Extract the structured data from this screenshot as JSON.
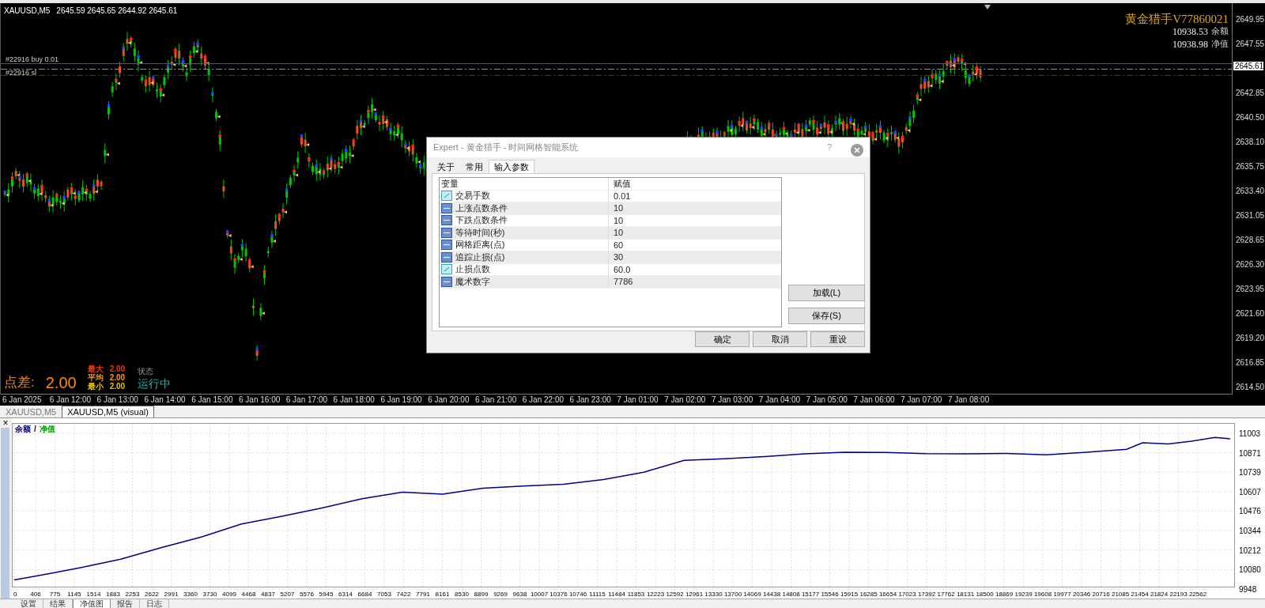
{
  "chart": {
    "symbol": "XAUUSD,M5",
    "ohlc": "2645.59 2645.65 2644.92 2645.61",
    "order_labels": [
      "#22916 buy 0.01",
      "#22916 sl"
    ],
    "ea_panel": {
      "title": "黄金猎手V77860021",
      "balance": {
        "amount": "10938.53",
        "caption": "余额"
      },
      "equity": {
        "amount": "10938.98",
        "caption": "净值"
      }
    },
    "spread_panel": {
      "label": "点差:",
      "value": "2.00",
      "stats": [
        {
          "label": "最大",
          "value": "2.00",
          "color": "#ff3300"
        },
        {
          "label": "平均",
          "value": "2.00",
          "color": "#ff9900"
        },
        {
          "label": "最小",
          "value": "2.00",
          "color": "#e6c200"
        }
      ],
      "status_label": "状态",
      "status_value": "运行中"
    },
    "price_axis": [
      "2649.95",
      "2647.55",
      "2642.85",
      "2640.50",
      "2638.10",
      "2635.75",
      "2633.40",
      "2631.05",
      "2628.65",
      "2626.30",
      "2623.95",
      "2621.60",
      "2619.20",
      "2616.85",
      "2614.50"
    ],
    "current_price": "2645.61",
    "time_axis": [
      "6 Jan 2025",
      "6 Jan 12:00",
      "6 Jan 13:00",
      "6 Jan 14:00",
      "6 Jan 15:00",
      "6 Jan 16:00",
      "6 Jan 17:00",
      "6 Jan 18:00",
      "6 Jan 19:00",
      "6 Jan 20:00",
      "6 Jan 21:00",
      "6 Jan 22:00",
      "6 Jan 23:00",
      "7 Jan 01:00",
      "7 Jan 02:00",
      "7 Jan 03:00",
      "7 Jan 04:00",
      "7 Jan 05:00",
      "7 Jan 06:00",
      "7 Jan 07:00",
      "7 Jan 08:00"
    ]
  },
  "chart_tabs": [
    {
      "label": "XAUUSD,M5",
      "selected": false
    },
    {
      "label": "XAUUSD,M5 (visual)",
      "selected": true
    }
  ],
  "dialog": {
    "title": "Expert - 黄金猎手 - 时间网格智能系统",
    "help": "?",
    "tabs": [
      {
        "label": "关于",
        "selected": false
      },
      {
        "label": "常用",
        "selected": false
      },
      {
        "label": "输入参数",
        "selected": true
      }
    ],
    "columns": [
      "变量",
      "赋值"
    ],
    "rows": [
      {
        "kind": "double",
        "name": "交易手数",
        "value": "0.01"
      },
      {
        "kind": "int",
        "name": "上涨点数条件",
        "value": "10"
      },
      {
        "kind": "int",
        "name": "下跌点数条件",
        "value": "10"
      },
      {
        "kind": "int",
        "name": "等待时间(秒)",
        "value": "10"
      },
      {
        "kind": "int",
        "name": "网格距离(点)",
        "value": "60"
      },
      {
        "kind": "int",
        "name": "追踪止损(点)",
        "value": "30"
      },
      {
        "kind": "double",
        "name": "止损点数",
        "value": "60.0"
      },
      {
        "kind": "int",
        "name": "魔术数字",
        "value": "7786"
      }
    ],
    "side_buttons": [
      "加载(L)",
      "保存(S)"
    ],
    "buttons": [
      "确定",
      "取消",
      "重设"
    ]
  },
  "tester": {
    "close": "×",
    "legend_extra": {
      "label": "净值",
      "color": "#009900"
    },
    "legend_separator": "/",
    "chart_data": {
      "type": "line",
      "grid": true,
      "x": [
        0,
        630,
        1263,
        2030,
        2797,
        3564,
        4331,
        5100,
        5866,
        6633,
        7400,
        8167,
        8934,
        9700,
        10468,
        11235,
        12002,
        12769,
        13536,
        14303,
        15070,
        15837,
        16604,
        17371,
        18138,
        18905,
        19672,
        20439,
        21206,
        21507,
        22000,
        22440,
        22891,
        23177
      ],
      "series": [
        {
          "name": "余额",
          "color": "#00008b",
          "values": [
            10010,
            10050,
            10093,
            10150,
            10228,
            10300,
            10389,
            10440,
            10497,
            10560,
            10604,
            10590,
            10631,
            10645,
            10658,
            10690,
            10739,
            10820,
            10830,
            10845,
            10863,
            10875,
            10873,
            10865,
            10863,
            10866,
            10857,
            10875,
            10895,
            10938,
            10930,
            10949,
            10975,
            10965
          ]
        }
      ],
      "xlim": [
        0,
        23209
      ],
      "ylim": [
        9948,
        11003
      ],
      "xticks": [
        0,
        406,
        775,
        1145,
        1514,
        1883,
        2253,
        2622,
        2991,
        3360,
        3730,
        4099,
        4468,
        4837,
        5207,
        5576,
        5945,
        6314,
        6684,
        7053,
        7422,
        7791,
        8161,
        8530,
        8899,
        9269,
        9638,
        10007,
        10376,
        10746,
        11115,
        11484,
        11853,
        12223,
        12592,
        12961,
        13330,
        13700,
        14069,
        14438,
        14808,
        15177,
        15546,
        15915,
        16285,
        16654,
        17023,
        17392,
        17762,
        18131,
        18500,
        18869,
        19239,
        19608,
        19977,
        20346,
        20716,
        21085,
        21454,
        21824,
        22193,
        22562
      ],
      "yticks": [
        9948,
        10080,
        10212,
        10344,
        10476,
        10607,
        10739,
        10871,
        11003
      ]
    }
  },
  "tester_tabs": [
    {
      "label": "设置",
      "selected": false
    },
    {
      "label": "结果",
      "selected": false
    },
    {
      "label": "净值图",
      "selected": true
    },
    {
      "label": "报告",
      "selected": false
    },
    {
      "label": "日志",
      "selected": false
    }
  ]
}
